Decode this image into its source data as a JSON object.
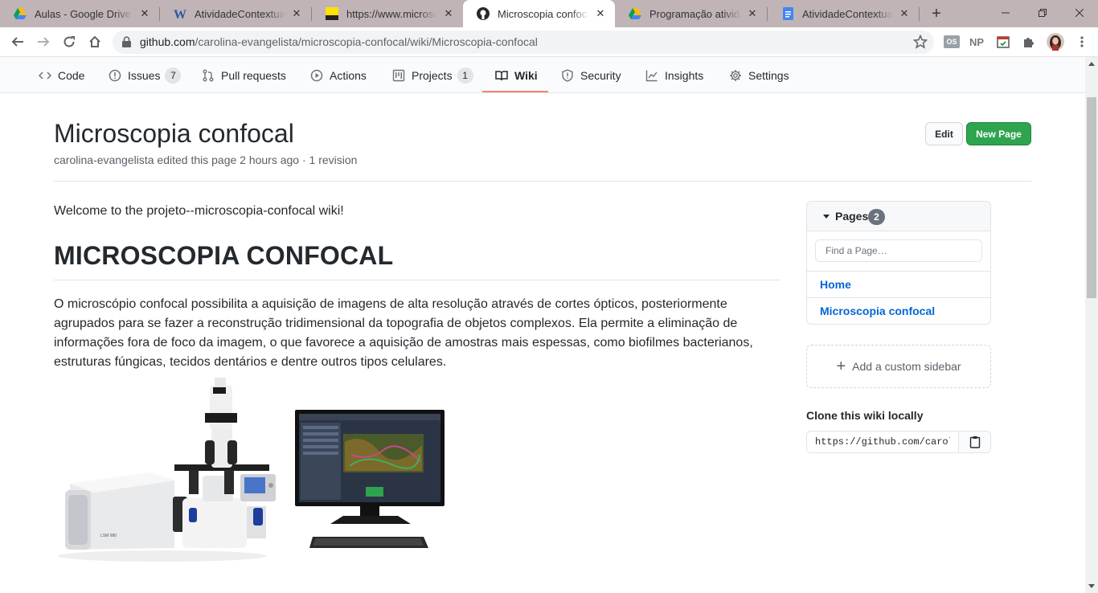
{
  "browser": {
    "tabs": [
      {
        "title": "Aulas - Google Drive",
        "icon": "google-drive-icon"
      },
      {
        "title": "AtividadeContextualizada",
        "icon": "word-icon"
      },
      {
        "title": "https://www.microscopia",
        "icon": "nikon-icon"
      },
      {
        "title": "Microscopia confocal · carolina",
        "icon": "github-icon",
        "active": true
      },
      {
        "title": "Programação atividades",
        "icon": "google-drive-icon"
      },
      {
        "title": "AtividadeContextualizada",
        "icon": "google-docs-icon"
      }
    ],
    "new_tab": "+",
    "url_host": "github.com",
    "url_path": "/carolina-evangelista/microscopia-confocal/wiki/Microscopia-confocal",
    "extensions": [
      "OS",
      "NP"
    ]
  },
  "repo_nav": {
    "items": [
      {
        "label": "Code",
        "icon": "code-icon"
      },
      {
        "label": "Issues",
        "icon": "issue-icon",
        "count": "7"
      },
      {
        "label": "Pull requests",
        "icon": "pull-request-icon"
      },
      {
        "label": "Actions",
        "icon": "play-icon"
      },
      {
        "label": "Projects",
        "icon": "project-icon",
        "count": "1"
      },
      {
        "label": "Wiki",
        "icon": "book-icon",
        "selected": true
      },
      {
        "label": "Security",
        "icon": "shield-icon"
      },
      {
        "label": "Insights",
        "icon": "graph-icon"
      },
      {
        "label": "Settings",
        "icon": "gear-icon"
      }
    ],
    "selected_accent": "#f9826c"
  },
  "wiki": {
    "title": "Microscopia confocal",
    "meta": "carolina-evangelista edited this page 2 hours ago · 1 revision",
    "edit_label": "Edit",
    "new_page_label": "New Page",
    "welcome": "Welcome to the projeto--microscopia-confocal wiki!",
    "heading": "MICROSCOPIA CONFOCAL",
    "paragraph": "O microscópio confocal possibilita a aquisição de imagens de alta resolução através de cortes ópticos, posteriormente agrupados para se fazer a reconstrução tridimensional da topografia de objetos complexos. Ela permite a eliminação de informações fora de foco da imagem, o que favorece a aquisição de amostras mais espessas, como biofilmes bacterianos, estruturas fúngicas, tecidos dentários e dentre outros tipos celulares.",
    "image_brand": "LSM 980"
  },
  "sidebar": {
    "pages_label": "Pages",
    "pages_count": "2",
    "find_placeholder": "Find a Page…",
    "pages": [
      "Home",
      "Microscopia confocal"
    ],
    "custom_sidebar": "Add a custom sidebar",
    "clone_title": "Clone this wiki locally",
    "clone_url": "https://github.com/carolina-evangelista/microscopia-confocal.wiki.git"
  },
  "colors": {
    "primary_button": "#2ea44f",
    "link": "#0366d6",
    "tabstrip": "#c0b4b6"
  }
}
